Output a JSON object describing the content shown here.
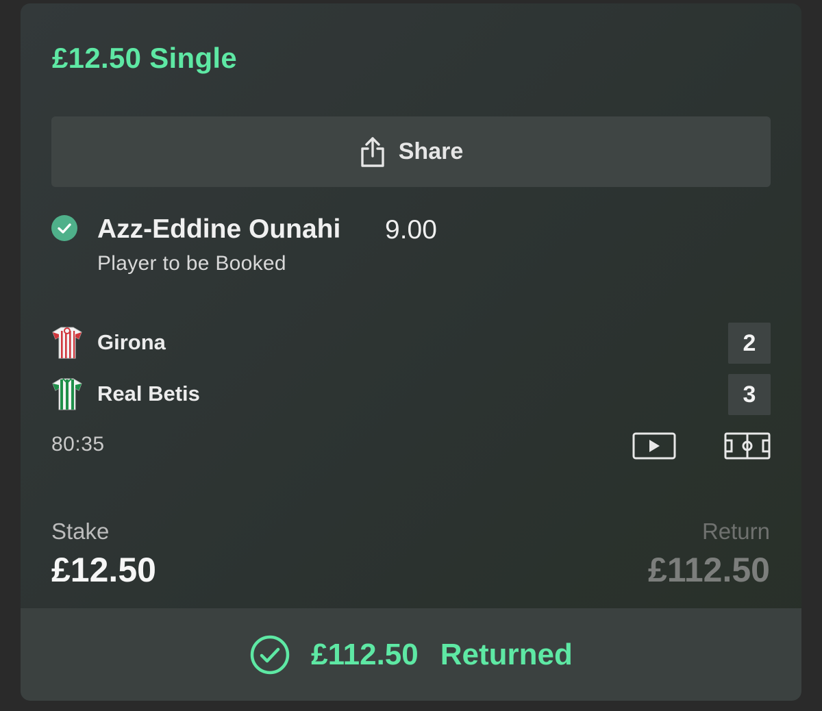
{
  "bet": {
    "title": "£12.50 Single",
    "share_label": "Share",
    "selection": {
      "name": "Azz-Eddine Ounahi",
      "odds": "9.00",
      "market": "Player to be Booked",
      "status_icon": "check-circle-icon"
    },
    "match": {
      "teams": [
        {
          "name": "Girona",
          "score": "2",
          "kit_icon": "girona-kit-icon"
        },
        {
          "name": "Real Betis",
          "score": "3",
          "kit_icon": "betis-kit-icon"
        }
      ],
      "clock": "80:35",
      "stream_icon": "play-icon",
      "pitch_icon": "pitch-icon"
    },
    "stake": {
      "label": "Stake",
      "value": "£12.50"
    },
    "return": {
      "label": "Return",
      "value": "£112.50"
    },
    "result": {
      "amount": "£112.50",
      "text": "Returned",
      "icon": "check-circle-outline-icon"
    }
  },
  "colors": {
    "accent": "#5ee8a4",
    "check_fill": "#4fb08a",
    "card_bg": "#30363a",
    "button_bg": "#3f4544"
  }
}
